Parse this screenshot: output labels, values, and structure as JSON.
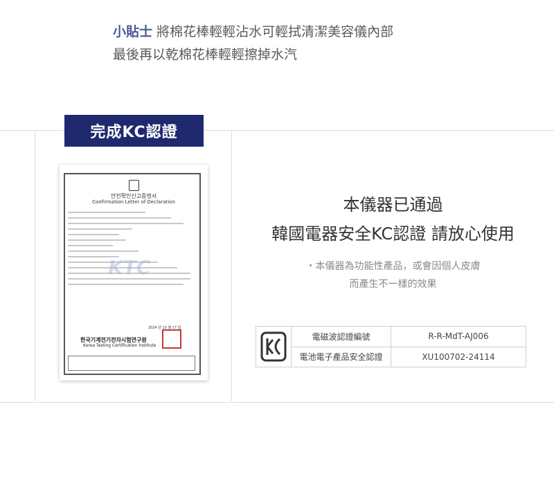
{
  "tip": {
    "label": "小貼士",
    "line1": "將棉花棒輕輕沾水可輕拭清潔美容儀內部",
    "line2": "最後再以乾棉花棒輕輕擦掉水汽"
  },
  "badge": "完成KC認證",
  "certificate": {
    "title_ko": "안전확인신고증명서",
    "title_en": "Confirmation Letter of Declaration",
    "watermark": "KTC",
    "org_ko": "한국기계전기전자시험연구원",
    "org_en": "Korea Testing Certification Institute",
    "date": "2024 년 10 월 17 일"
  },
  "headline": {
    "line1": "本儀器已通過",
    "line2": "韓國電器安全KC認證 請放心使用"
  },
  "note": {
    "line1": "・本儀器為功能性產品，或會因個人皮膚",
    "line2": "而產生不一樣的效果"
  },
  "table": {
    "rows": [
      {
        "key": "電磁波認證編號",
        "value": "R-R-MdT-AJ006"
      },
      {
        "key": "電池電子產品安全認證",
        "value": "XU100702-24114"
      }
    ]
  }
}
